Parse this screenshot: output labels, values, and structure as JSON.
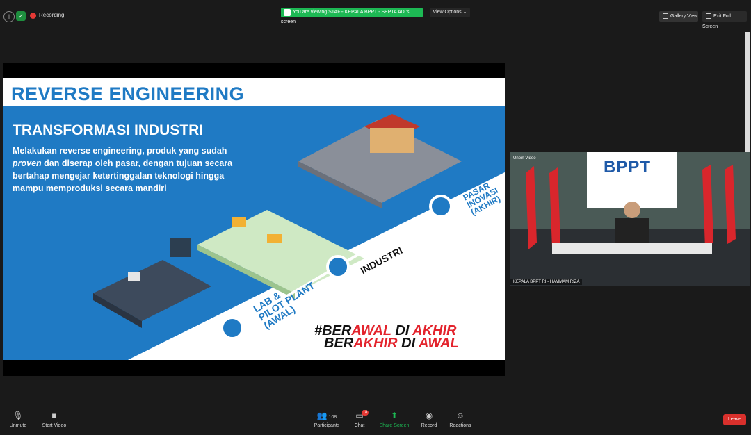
{
  "topbar": {
    "recording_label": "Recording",
    "share_banner": "You are viewing STAFF KEPALA BPPT - SEPTA ADI's screen",
    "view_options": "View Options ⌄",
    "gallery_view": "Gallery View",
    "exit_fullscreen": "Exit Full Screen"
  },
  "slide": {
    "title": "REVERSE ENGINEERING",
    "subtitle": "TRANSFORMASI INDUSTRI",
    "body_parts": [
      "Melakukan reverse engineering, produk yang sudah ",
      "proven",
      " dan diserap oleh pasar, dengan tujuan secara bertahap mengejar ketertinggalan teknologi hingga mampu memproduksi secara mandiri"
    ],
    "stage1_line1": "LAB &",
    "stage1_line2": "PILOT PLANT",
    "stage1_line3": "(AWAL)",
    "stage2": "INDUSTRI",
    "stage3_line1": "PASAR",
    "stage3_line2": "INOVASI",
    "stage3_line3": "(AKHIR)",
    "hashtag_line1_a": "#BER",
    "hashtag_line1_b": "AWAL",
    "hashtag_line1_c": " DI ",
    "hashtag_line1_d": "AKHIR",
    "hashtag_line2_a": "BER",
    "hashtag_line2_b": "AKHIR",
    "hashtag_line2_c": " DI ",
    "hashtag_line2_d": "AWAL",
    "colors": {
      "blue": "#1f7ac4",
      "red": "#e3232c"
    }
  },
  "video": {
    "unpin_label": "Unpin Video",
    "logo_text": "BPPT",
    "speaker_name": "KEPALA BPPT RI - HAMMAM RIZA"
  },
  "toolbar": {
    "unmute": "Unmute",
    "start_video": "Start Video",
    "participants": "Participants",
    "participants_count": "108",
    "chat": "Chat",
    "chat_badge": "18",
    "share_screen": "Share Screen",
    "record": "Record",
    "reactions": "Reactions",
    "leave": "Leave"
  }
}
